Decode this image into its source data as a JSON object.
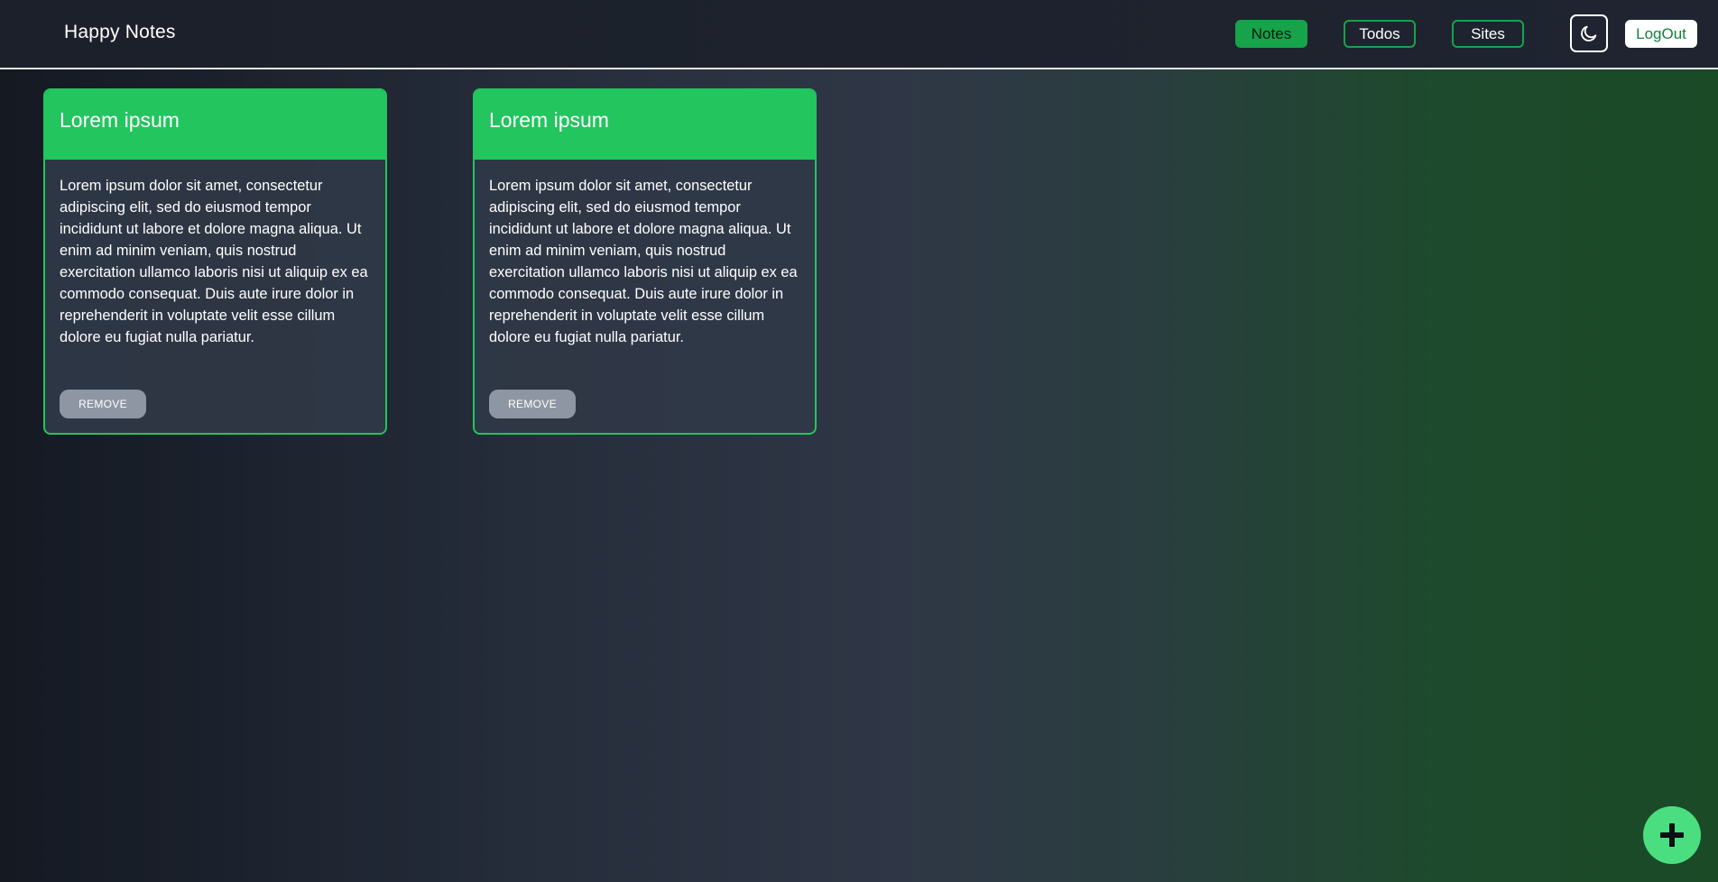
{
  "app": {
    "title": "Happy Notes"
  },
  "nav": {
    "notes_label": "Notes",
    "todos_label": "Todos",
    "sites_label": "Sites",
    "theme_icon": "moon-icon",
    "logout_label": "LogOut"
  },
  "notes": [
    {
      "title": "Lorem ipsum",
      "body": "Lorem ipsum dolor sit amet, consectetur adipiscing elit, sed do eiusmod tempor incididunt ut labore et dolore magna aliqua. Ut enim ad minim veniam, quis nostrud exercitation ullamco laboris nisi ut aliquip ex ea commodo consequat. Duis aute irure dolor in reprehenderit in voluptate velit esse cillum dolore eu fugiat nulla pariatur.",
      "remove_label": "REMOVE"
    },
    {
      "title": "Lorem ipsum",
      "body": "Lorem ipsum dolor sit amet, consectetur adipiscing elit, sed do eiusmod tempor incididunt ut labore et dolore magna aliqua. Ut enim ad minim veniam, quis nostrud exercitation ullamco laboris nisi ut aliquip ex ea commodo consequat. Duis aute irure dolor in reprehenderit in voluptate velit esse cillum dolore eu fugiat nulla pariatur.",
      "remove_label": "REMOVE"
    }
  ],
  "fab": {
    "icon": "plus-icon"
  },
  "colors": {
    "accent": "#22c55e",
    "accent_dark": "#16a34a",
    "fab": "#4ade80",
    "remove_button": "#8f96a3"
  }
}
